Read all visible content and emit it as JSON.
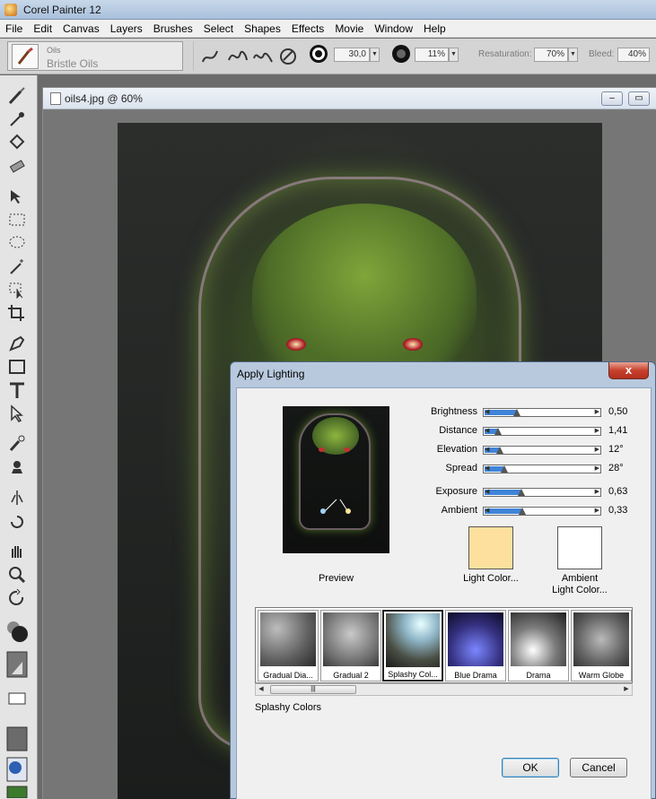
{
  "app": {
    "title": "Corel Painter 12"
  },
  "menu": [
    "File",
    "Edit",
    "Canvas",
    "Layers",
    "Brushes",
    "Select",
    "Shapes",
    "Effects",
    "Movie",
    "Window",
    "Help"
  ],
  "propbar": {
    "brush_category": "Oils",
    "brush_variant": "Bristle Oils",
    "size_value": "30,0",
    "opacity_value": "11%",
    "resaturation_label": "Resaturation:",
    "resaturation_value": "70%",
    "bleed_label": "Bleed:",
    "bleed_value": "40%"
  },
  "document": {
    "title": "oils4.jpg @ 60%"
  },
  "dialog": {
    "title": "Apply Lighting",
    "close_label": "x",
    "preview_label": "Preview",
    "sliders": [
      {
        "label": "Brightness",
        "value": "0,50",
        "fraction": 0.28
      },
      {
        "label": "Distance",
        "value": "1,41",
        "fraction": 0.12
      },
      {
        "label": "Elevation",
        "value": "12°",
        "fraction": 0.13
      },
      {
        "label": "Spread",
        "value": "28°",
        "fraction": 0.17
      },
      {
        "label": "Exposure",
        "value": "0,63",
        "fraction": 0.32
      },
      {
        "label": "Ambient",
        "value": "0,33",
        "fraction": 0.33
      }
    ],
    "light_color_label": "Light Color...",
    "ambient_color_label_1": "Ambient",
    "ambient_color_label_2": "Light Color...",
    "light_color": "#fde09e",
    "ambient_color": "#ffffff",
    "presets": [
      "Gradual Dia...",
      "Gradual 2",
      "Splashy Col...",
      "Blue Drama",
      "Drama",
      "Warm Globe"
    ],
    "selected_preset_name": "Splashy Colors",
    "ok_label": "OK",
    "cancel_label": "Cancel"
  }
}
